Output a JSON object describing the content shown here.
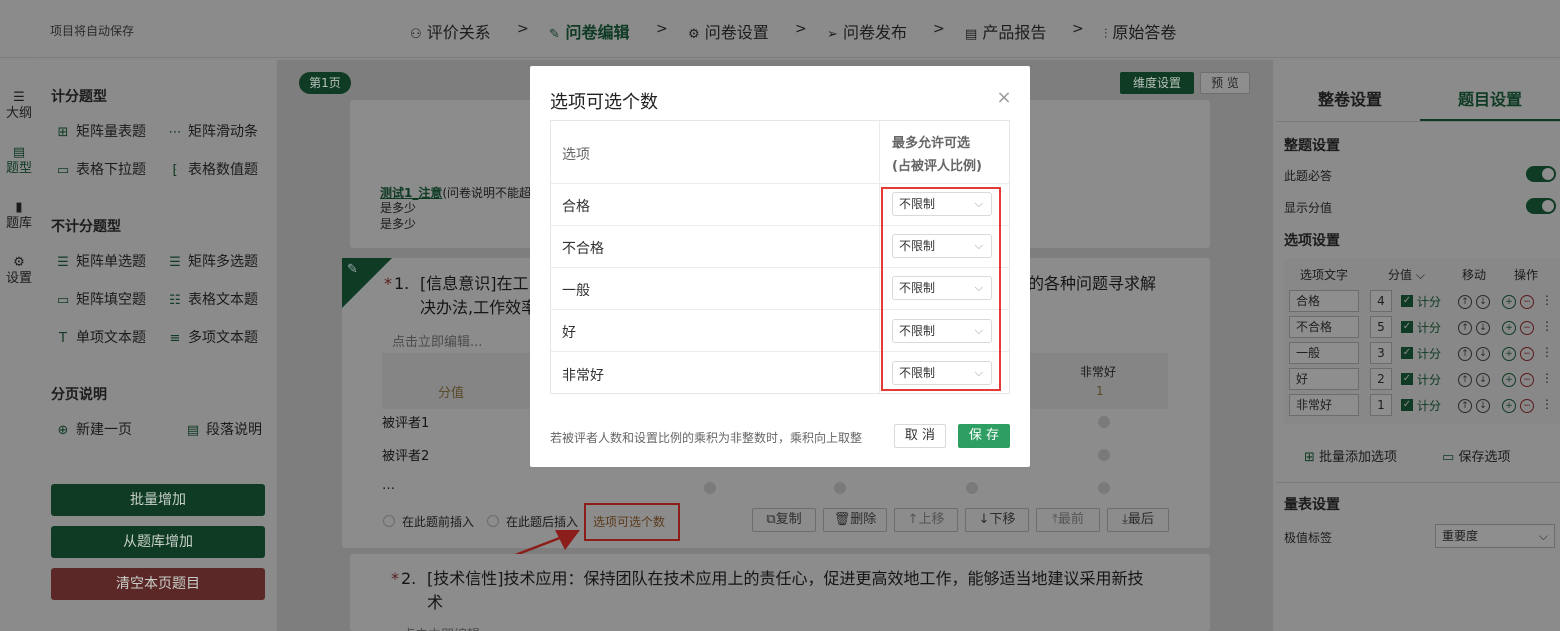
{
  "header": {
    "autosave": "项目将自动保存",
    "steps": [
      {
        "label": "评价关系",
        "icon": "users-icon"
      },
      {
        "label": "问卷编辑",
        "icon": "edit-icon"
      },
      {
        "label": "问卷设置",
        "icon": "gear-icon"
      },
      {
        "label": "问卷发布",
        "icon": "send-icon"
      },
      {
        "label": "产品报告",
        "icon": "report-icon"
      },
      {
        "label": "原始答卷",
        "icon": "chart-icon"
      }
    ],
    "separator": ">"
  },
  "rail": [
    "大纲",
    "题型",
    "题库",
    "设置"
  ],
  "left_panel": {
    "scored_title": "计分题型",
    "scored": [
      "矩阵量表题",
      "矩阵滑动条",
      "表格下拉题",
      "表格数值题"
    ],
    "unscored_title": "不计分题型",
    "unscored": [
      "矩阵单选题",
      "矩阵多选题",
      "矩阵填空题",
      "表格文本题",
      "单项文本题",
      "多项文本题"
    ],
    "paging_title": "分页说明",
    "paging": [
      "新建一页",
      "段落说明"
    ],
    "btn_batch": "批量增加",
    "btn_bank": "从题库增加",
    "btn_clear": "清空本页题目"
  },
  "canvas": {
    "page_badge": "第1页",
    "dim_btn": "维度设置",
    "preview_btn": "预 览",
    "intro_link": "测试1_注意",
    "intro_rest": "(问卷说明不能超",
    "intro_line2": "是多少",
    "intro_line3": "是多少",
    "q1_star": "*",
    "q1_num": "1.",
    "q1_text_a": "[信息意识]在工",
    "q1_text_right": "的各种问题寻求解",
    "q1_text_b": "决办法,工作效率",
    "q1_edit": "点击立即编辑...",
    "col_score": "分值",
    "col_last": "非常好",
    "col_last_score": "1",
    "rows": [
      "被评者1",
      "被评者2",
      "…"
    ],
    "insert_before": "在此题前插入",
    "insert_after": "在此题后插入",
    "option_count_link": "选项可选个数",
    "actions": [
      "复制",
      "删除",
      "上移",
      "下移",
      "最前",
      "最后"
    ],
    "q2_star": "*",
    "q2_num": "2.",
    "q2_text": "[技术信性]技术应用：保持团队在技术应用上的责任心，促进更高效地工作，能够适当地建议采用新技",
    "q2_text2": "术",
    "q2_edit": "点击立即编辑..."
  },
  "right_panel": {
    "tab_whole": "整卷设置",
    "tab_question": "题目设置",
    "whole_title": "整题设置",
    "required": "此题必答",
    "show_score": "显示分值",
    "option_title": "选项设置",
    "col_text": "选项文字",
    "col_score": "分值",
    "col_move": "移动",
    "col_ops": "操作",
    "options": [
      {
        "text": "合格",
        "score": "4",
        "count": "计分"
      },
      {
        "text": "不合格",
        "score": "5",
        "count": "计分"
      },
      {
        "text": "一般",
        "score": "3",
        "count": "计分"
      },
      {
        "text": "好",
        "score": "2",
        "count": "计分"
      },
      {
        "text": "非常好",
        "score": "1",
        "count": "计分"
      }
    ],
    "batch_add": "批量添加选项",
    "save_options": "保存选项",
    "scale_title": "量表设置",
    "extreme_label": "极值标签",
    "extreme_value": "重要度"
  },
  "modal": {
    "title": "选项可选个数",
    "head_option": "选项",
    "head_max_1": "最多允许可选",
    "head_max_2": "(占被评人比例)",
    "rows": [
      {
        "option": "合格",
        "limit": "不限制"
      },
      {
        "option": "不合格",
        "limit": "不限制"
      },
      {
        "option": "一般",
        "limit": "不限制"
      },
      {
        "option": "好",
        "limit": "不限制"
      },
      {
        "option": "非常好",
        "limit": "不限制"
      }
    ],
    "note": "若被评者人数和设置比例的乘积为非整数时，乘积向上取整",
    "cancel": "取 消",
    "save": "保 存"
  },
  "colors": {
    "brand_green": "#2e9e63",
    "highlight_red": "#e53935",
    "overlay": "#8a8a8a"
  }
}
